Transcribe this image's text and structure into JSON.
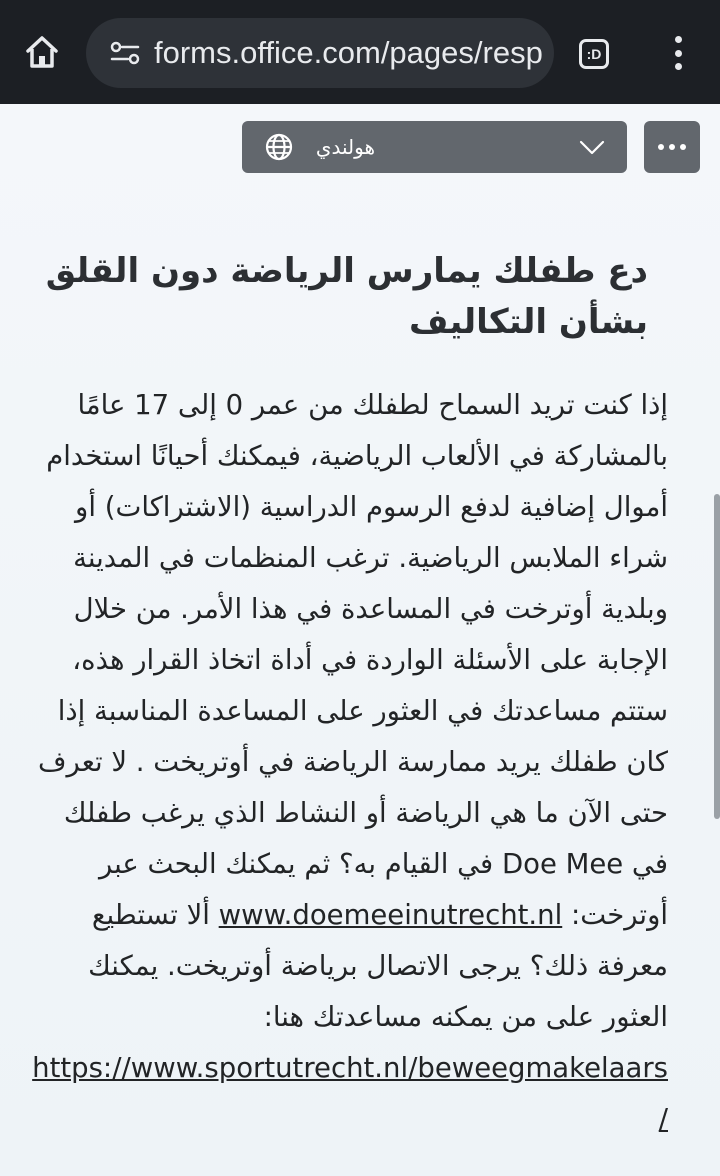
{
  "browser": {
    "url": "forms.office.com/pages/resp",
    "tab_label": ":D",
    "icons": [
      "home-icon",
      "site-settings-icon",
      "tab-switcher-icon",
      "more-vert-icon"
    ]
  },
  "language_select": {
    "selected": "هولندي",
    "icons": [
      "globe-icon",
      "chevron-down-icon"
    ]
  },
  "more_menu": {
    "icon": "more-horizontal-icon"
  },
  "form": {
    "title": "دع طفلك يمارس الرياضة دون القلق بشأن التكاليف",
    "body_intro": "إذا كنت تريد السماح لطفلك من عمر 0 إلى 17 عامًا بالمشاركة في الألعاب الرياضية، فيمكنك أحيانًا استخدام أموال إضافية لدفع الرسوم الدراسية (الاشتراكات) أو شراء الملابس الرياضية. ترغب المنظمات في المدينة وبلدية أوترخت في المساعدة في هذا الأمر. من خلال الإجابة على الأسئلة الواردة في أداة اتخاذ القرار هذه، ستتم مساعدتك في العثور على المساعدة المناسبة إذا كان طفلك يريد ممارسة الرياضة في أوتريخت . لا تعرف حتى الآن ما هي الرياضة أو النشاط الذي يرغب طفلك في Doe Mee في القيام به؟ ثم يمكنك البحث عبر أوترخت: ",
    "link1": "www.doemeeinutrecht.nl",
    "body_middle": " ألا تستطيع معرفة ذلك؟ يرجى الاتصال برياضة أوتريخت. يمكنك العثور على من يمكنه مساعدتك هنا: ",
    "link2": "https://www.sportutrecht.nl/beweegmakelaars/"
  },
  "colors": {
    "browser_bar": "#1c1f24",
    "url_pill": "#2e3238",
    "select_bg": "#62676d",
    "page_bg": "#eef3f8",
    "text": "#222426"
  }
}
